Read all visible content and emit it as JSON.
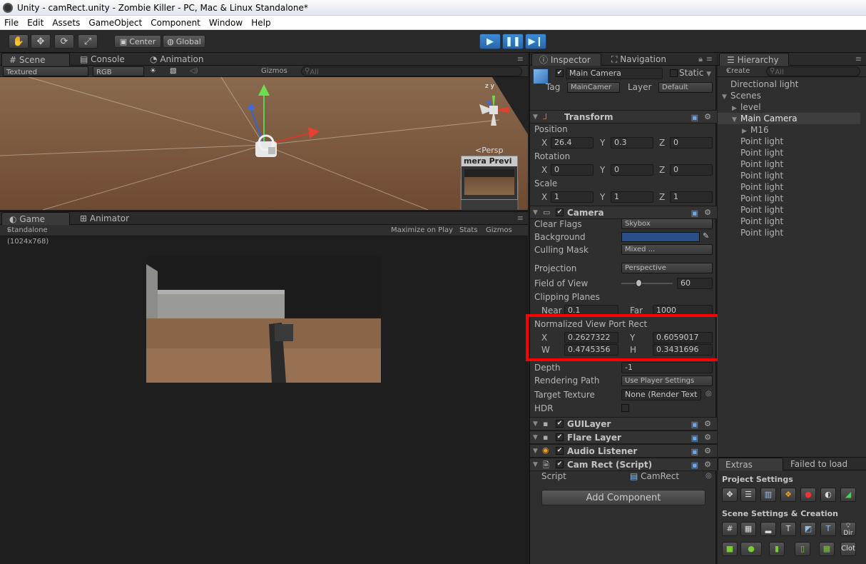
{
  "window": {
    "title": "Unity - camRect.unity - Zombie Killer - PC, Mac & Linux Standalone*"
  },
  "menu": [
    "File",
    "Edit",
    "Assets",
    "GameObject",
    "Component",
    "Window",
    "Help"
  ],
  "toolbar": {
    "center_label": "Center",
    "global_label": "Global"
  },
  "scene": {
    "tabs": [
      "Scene",
      "Console",
      "Animation"
    ],
    "shading": "Textured",
    "render_mode": "RGB",
    "gizmos": "Gizmos",
    "search_placeholder": "All",
    "persp": "Persp",
    "camera_preview": "mera Previ"
  },
  "game": {
    "tabs": [
      "Game",
      "Animator"
    ],
    "resolution": "Standalone (1024x768)",
    "maximize": "Maximize on Play",
    "stats": "Stats",
    "gizmos": "Gizmos"
  },
  "inspector": {
    "tabs": [
      "Inspector",
      "Navigation"
    ],
    "object_name": "Main Camera",
    "static_label": "Static",
    "tag_label": "Tag",
    "tag_value": "MainCamer",
    "layer_label": "Layer",
    "layer_value": "Default",
    "transform": {
      "title": "Transform",
      "position_label": "Position",
      "position": [
        "26.4",
        "0.3",
        "0"
      ],
      "rotation_label": "Rotation",
      "rotation": [
        "0",
        "0",
        "0"
      ],
      "scale_label": "Scale",
      "scale": [
        "1",
        "1",
        "1"
      ]
    },
    "camera": {
      "title": "Camera",
      "clear_flags_label": "Clear Flags",
      "clear_flags": "Skybox",
      "background_label": "Background",
      "background_color": "#2a4f86",
      "culling_label": "Culling Mask",
      "culling": "Mixed ...",
      "projection_label": "Projection",
      "projection": "Perspective",
      "fov_label": "Field of View",
      "fov": "60",
      "fov_fraction": 0.33,
      "clipping_label": "Clipping Planes",
      "near_label": "Near",
      "near": "0.1",
      "far_label": "Far",
      "far": "1000",
      "viewport_label": "Normalized View Port Rect",
      "vx": "0.2627322",
      "vy": "0.6059017",
      "vw": "0.4745356",
      "vh": "0.3431696",
      "depth_label": "Depth",
      "depth": "-1",
      "render_path_label": "Rendering Path",
      "render_path": "Use Player Settings",
      "target_label": "Target Texture",
      "target": "None (Render Text",
      "hdr_label": "HDR"
    },
    "components": [
      "GUILayer",
      "Flare Layer",
      "Audio Listener",
      "Cam Rect (Script)"
    ],
    "script_label": "Script",
    "script_value": "CamRect",
    "add_component": "Add Component"
  },
  "hierarchy": {
    "tab": "Hierarchy",
    "create": "Create",
    "search_placeholder": "All",
    "items": [
      {
        "label": "Directional light",
        "indent": 0,
        "arrow": ""
      },
      {
        "label": "Scenes",
        "indent": 0,
        "arrow": "▼"
      },
      {
        "label": "level",
        "indent": 1,
        "arrow": "▶"
      },
      {
        "label": "Main Camera",
        "indent": 1,
        "arrow": "▼",
        "selected": true
      },
      {
        "label": "M16",
        "indent": 2,
        "arrow": "▶"
      },
      {
        "label": "Point light",
        "indent": 1,
        "arrow": ""
      },
      {
        "label": "Point light",
        "indent": 1,
        "arrow": ""
      },
      {
        "label": "Point light",
        "indent": 1,
        "arrow": ""
      },
      {
        "label": "Point light",
        "indent": 1,
        "arrow": ""
      },
      {
        "label": "Point light",
        "indent": 1,
        "arrow": ""
      },
      {
        "label": "Point light",
        "indent": 1,
        "arrow": ""
      },
      {
        "label": "Point light",
        "indent": 1,
        "arrow": ""
      },
      {
        "label": "Point light",
        "indent": 1,
        "arrow": ""
      },
      {
        "label": "Point light",
        "indent": 1,
        "arrow": ""
      }
    ]
  },
  "extras": {
    "tab": "Extras",
    "failed": "Failed to load",
    "project_settings": "Project Settings",
    "scene_settings": "Scene Settings & Creation",
    "dir_label": "Dir",
    "cloth_label": "Clot"
  }
}
